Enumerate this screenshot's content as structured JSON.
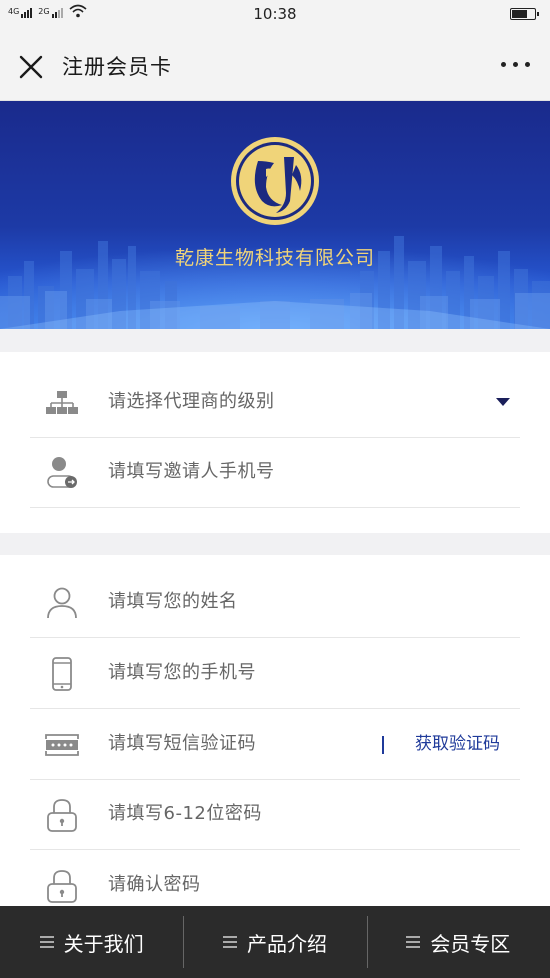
{
  "status_bar": {
    "network_1": "4G",
    "network_2": "2G",
    "time": "10:38"
  },
  "nav": {
    "title": "注册会员卡",
    "close_icon": "close-icon",
    "more_icon": "more-dots-icon"
  },
  "banner": {
    "company_name": "乾康生物科技有限公司",
    "logo_color": "#f0d479",
    "background": "#1d3aa6"
  },
  "form": {
    "agent_level_placeholder": "请选择代理商的级别",
    "inviter_phone_placeholder": "请填写邀请人手机号",
    "name_placeholder": "请填写您的姓名",
    "phone_placeholder": "请填写您的手机号",
    "sms_code_placeholder": "请填写短信验证码",
    "get_code_label": "获取验证码",
    "password_placeholder": "请填写6-12位密码",
    "confirm_password_placeholder": "请确认密码"
  },
  "tabbar": {
    "tabs": [
      {
        "label": "关于我们"
      },
      {
        "label": "产品介绍"
      },
      {
        "label": "会员专区"
      }
    ]
  },
  "colors": {
    "accent": "#1f3a9a",
    "tabbar_bg": "#2b2b2b",
    "gold": "#f0d479"
  }
}
